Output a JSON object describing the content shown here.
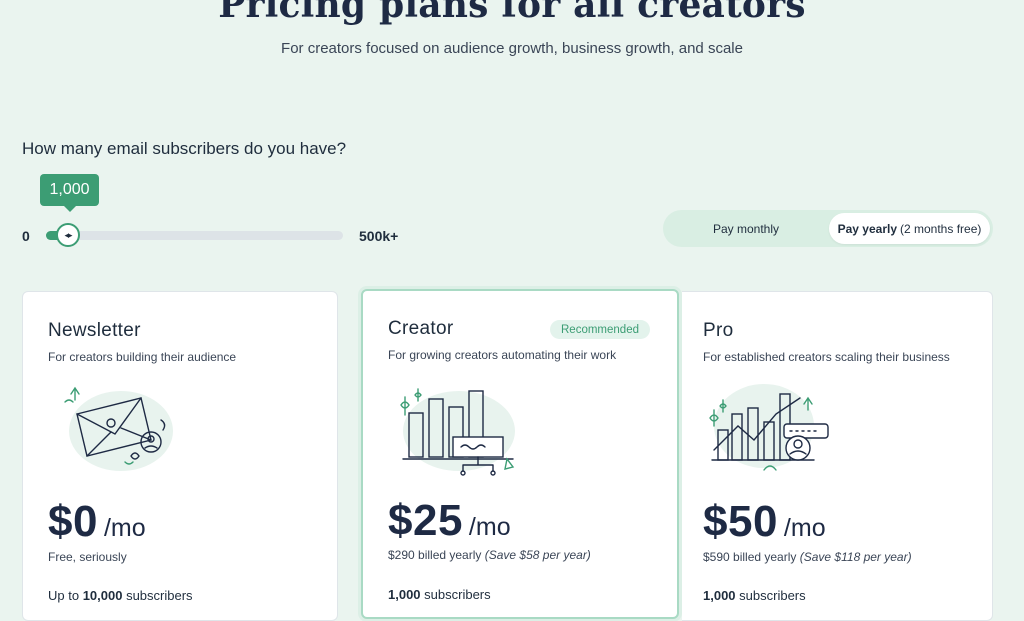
{
  "hero": {
    "title": "Pricing plans for all creators",
    "subtitle": "For creators focused on audience growth, business growth, and scale"
  },
  "slider": {
    "question": "How many email subscribers do you have?",
    "value_label": "1,000",
    "min_label": "0",
    "max_label": "500k+",
    "thumb_glyph": "◂▸",
    "position_fraction": 0.07
  },
  "billing_toggle": {
    "monthly_label": "Pay monthly",
    "yearly_label": "Pay yearly",
    "yearly_note": "(2 months free)",
    "selected": "yearly"
  },
  "plans": [
    {
      "name": "Newsletter",
      "description": "For creators building their audience",
      "price": "$0",
      "period": "/mo",
      "note": "Free, seriously",
      "note_extra": "",
      "subs_prefix": "Up to ",
      "subs_count": "10,000",
      "subs_suffix": " subscribers",
      "illustration": "envelope-illustration"
    },
    {
      "name": "Creator",
      "badge": "Recommended",
      "description": "For growing creators automating their work",
      "price": "$25",
      "period": "/mo",
      "note": "$290 billed yearly",
      "note_extra": "(Save $58 per year)",
      "subs_prefix": "",
      "subs_count": "1,000",
      "subs_suffix": " subscribers",
      "illustration": "bar-chart-illustration"
    },
    {
      "name": "Pro",
      "description": "For established creators scaling their business",
      "price": "$50",
      "period": "/mo",
      "note": "$590 billed yearly",
      "note_extra": "(Save $118 per year)",
      "subs_prefix": "",
      "subs_count": "1,000",
      "subs_suffix": " subscribers",
      "illustration": "growth-chart-illustration"
    }
  ],
  "colors": {
    "accent": "#3c9d74",
    "background": "#eaf4ef",
    "heading": "#1e2a44"
  }
}
